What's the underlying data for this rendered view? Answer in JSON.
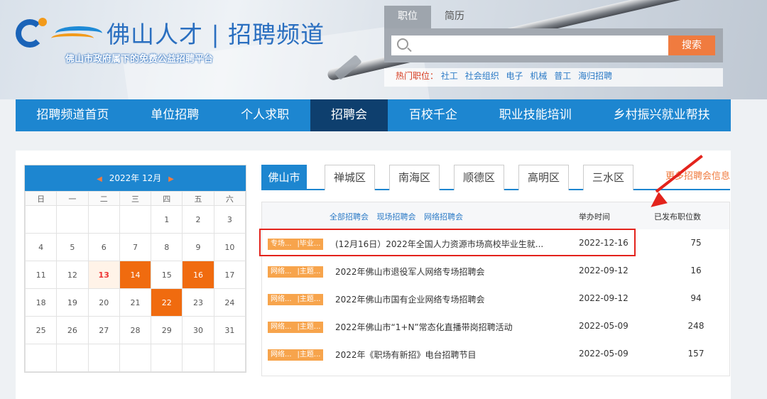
{
  "header": {
    "site_title": "佛山人才 | 招聘频道",
    "tagline": "佛山市政府属下的免费公益招聘平台"
  },
  "search": {
    "tabs": [
      "职位",
      "简历"
    ],
    "active_tab": "职位",
    "placeholder": "",
    "button": "搜索",
    "hot_label": "热门职位：",
    "hot_keywords": [
      "社工",
      "社会组织",
      "电子",
      "机械",
      "普工",
      "海归招聘"
    ]
  },
  "nav": {
    "items": [
      "招聘频道首页",
      "单位招聘",
      "个人求职",
      "招聘会",
      "百校千企",
      "职业技能培训",
      "乡村振兴就业帮扶"
    ],
    "active": "招聘会"
  },
  "calendar": {
    "month_label": "2022年 12月",
    "weekdays": [
      "日",
      "一",
      "二",
      "三",
      "四",
      "五",
      "六"
    ],
    "weeks": [
      [
        "",
        "",
        "",
        "",
        "1",
        "2",
        "3"
      ],
      [
        "4",
        "5",
        "6",
        "7",
        "8",
        "9",
        "10"
      ],
      [
        "11",
        "12",
        "13",
        "14",
        "15",
        "16",
        "17"
      ],
      [
        "18",
        "19",
        "20",
        "21",
        "22",
        "23",
        "24"
      ],
      [
        "25",
        "26",
        "27",
        "28",
        "29",
        "30",
        "31"
      ],
      [
        "",
        "",
        "",
        "",
        "",
        "",
        ""
      ]
    ],
    "today": "13",
    "event_days": [
      "14",
      "16",
      "22"
    ],
    "colors": {
      "header": "#1d86d0",
      "event": "#f06b0f",
      "today_text": "#e33333"
    }
  },
  "fairs": {
    "tabs": [
      "佛山市",
      "禅城区",
      "南海区",
      "顺德区",
      "高明区",
      "三水区"
    ],
    "active_tab": "佛山市",
    "more_link": "更多招聘会信息",
    "filters": [
      "全部招聘会",
      "现场招聘会",
      "网络招聘会"
    ],
    "col_date": "举办时间",
    "col_count": "已发布职位数",
    "rows": [
      {
        "tag1": "专场...",
        "tag2": "|毕业...",
        "title": "(12月16日）2022年全国人力资源市场高校毕业生就...",
        "date": "2022-12-16",
        "count": "75"
      },
      {
        "tag1": "网络...",
        "tag2": "|主题...",
        "title": "2022年佛山市退役军人网络专场招聘会",
        "date": "2022-09-12",
        "count": "16"
      },
      {
        "tag1": "网络...",
        "tag2": "|主题...",
        "title": "2022年佛山市国有企业网络专场招聘会",
        "date": "2022-09-12",
        "count": "94"
      },
      {
        "tag1": "网络...",
        "tag2": "|主题...",
        "title": "2022年佛山市“1+N”常态化直播带岗招聘活动",
        "date": "2022-05-09",
        "count": "248"
      },
      {
        "tag1": "网络...",
        "tag2": "|主题...",
        "title": "2022年《职场有新招》电台招聘节目",
        "date": "2022-05-09",
        "count": "157"
      }
    ]
  },
  "annotation": {
    "color": "#e3231c"
  }
}
